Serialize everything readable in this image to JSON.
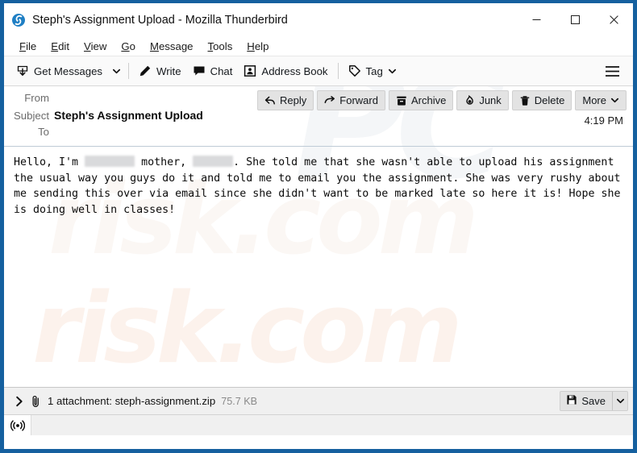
{
  "window": {
    "title": "Steph's Assignment Upload - Mozilla Thunderbird",
    "app_icon": "thunderbird-icon",
    "frame_color": "#15609f",
    "controls": {
      "minimize": "minimize-icon",
      "maximize": "maximize-icon",
      "close": "close-icon"
    }
  },
  "menubar": {
    "items": [
      {
        "label": "File",
        "accel": "F"
      },
      {
        "label": "Edit",
        "accel": "E"
      },
      {
        "label": "View",
        "accel": "V"
      },
      {
        "label": "Go",
        "accel": "G"
      },
      {
        "label": "Message",
        "accel": "M"
      },
      {
        "label": "Tools",
        "accel": "T"
      },
      {
        "label": "Help",
        "accel": "H"
      }
    ]
  },
  "toolbar": {
    "get_messages": "Get Messages",
    "get_messages_icon": "download-inbox-icon",
    "get_messages_dropdown": "chevron-down-icon",
    "write": "Write",
    "write_icon": "pencil-icon",
    "chat": "Chat",
    "chat_icon": "speech-bubble-icon",
    "address_book": "Address Book",
    "address_book_icon": "contact-card-icon",
    "tag": "Tag",
    "tag_icon": "tag-icon",
    "tag_dropdown": "chevron-down-icon",
    "app_menu_icon": "hamburger-icon"
  },
  "message_actions": [
    {
      "label": "Reply",
      "icon": "reply-arrow-icon"
    },
    {
      "label": "Forward",
      "icon": "forward-arrow-icon"
    },
    {
      "label": "Archive",
      "icon": "archive-box-icon"
    },
    {
      "label": "Junk",
      "icon": "junk-flame-icon"
    },
    {
      "label": "Delete",
      "icon": "trash-icon"
    },
    {
      "label": "More",
      "icon": "chevron-down-icon"
    }
  ],
  "headers": {
    "from_label": "From",
    "from_value": "",
    "subject_label": "Subject",
    "subject_value": "Steph's Assignment Upload",
    "to_label": "To",
    "to_value": "",
    "time": "4:19 PM"
  },
  "body": {
    "segments": [
      {
        "type": "text",
        "value": "Hello, I'm "
      },
      {
        "type": "redaction",
        "width": 62
      },
      {
        "type": "text",
        "value": " mother, "
      },
      {
        "type": "redaction",
        "width": 50
      },
      {
        "type": "text",
        "value": ". She told me that she wasn't able to upload his assignment the usual way you guys do it and told me to email you the assignment. She was very rushy about me sending this over via email since she didn't want to be marked late so here it is! Hope she is doing well in classes!"
      }
    ],
    "plain_text": "Hello, I'm [redacted] mother, [redacted]. She told me that she wasn't able to upload his assignment the usual way you guys do it and told me to email you the assignment. She was very rushy about me sending this over via email since she didn't want to be marked late so here it is! Hope she is doing well in classes!"
  },
  "attachment_bar": {
    "expander_icon": "chevron-right-icon",
    "clip_icon": "paperclip-icon",
    "summary": "1 attachment: steph-assignment.zip",
    "size": "75.7 KB",
    "save_label": "Save",
    "save_icon": "floppy-disk-icon",
    "save_dropdown_icon": "chevron-down-icon"
  },
  "statusbar": {
    "connection_icon": "broadcast-signal-icon"
  },
  "watermarks": {
    "primary": "risk.com",
    "secondary": "PC"
  }
}
